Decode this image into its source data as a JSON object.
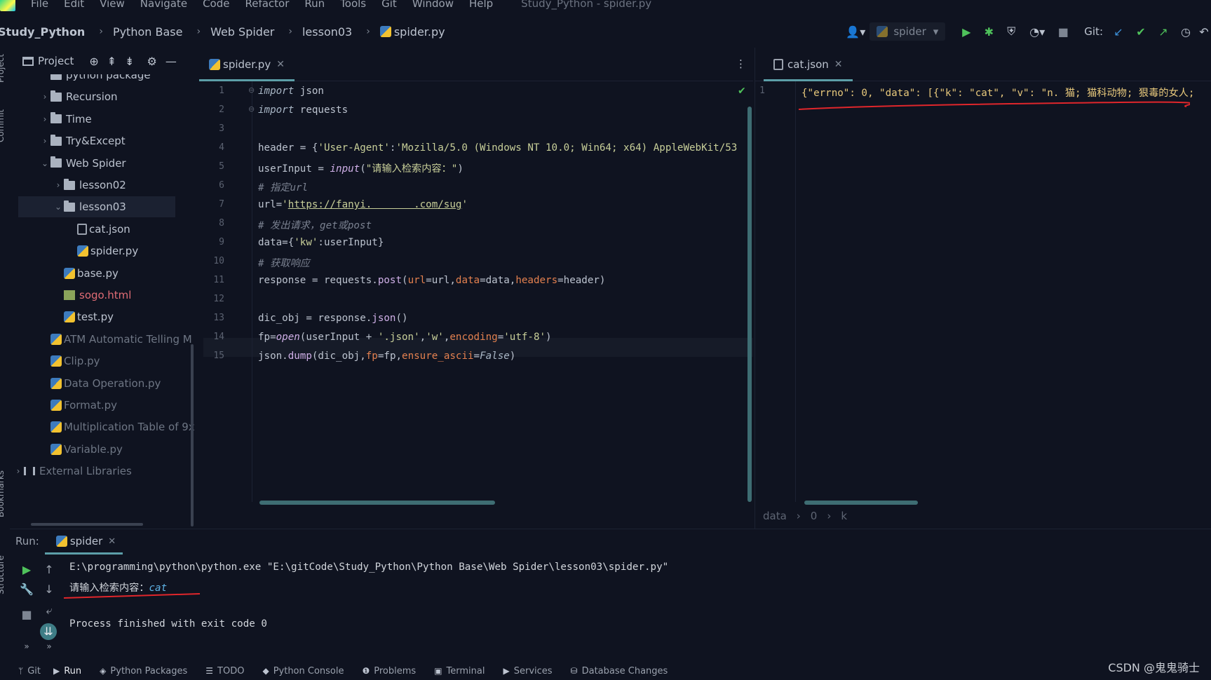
{
  "menubar": {
    "items": [
      "File",
      "Edit",
      "View",
      "Navigate",
      "Code",
      "Refactor",
      "Run",
      "Tools",
      "Git",
      "Window",
      "Help"
    ],
    "window_title": "Study_Python - spider.py"
  },
  "navbar": {
    "breadcrumb": [
      "Study_Python",
      "Python Base",
      "Web Spider",
      "lesson03",
      "spider.py"
    ],
    "run_config": "spider",
    "git_label": "Git:"
  },
  "side_labels": {
    "project": "Project",
    "commit": "Commit",
    "bookmarks": "Bookmarks",
    "structure": "Structure"
  },
  "project_panel": {
    "title": "Project",
    "tree": [
      {
        "label": "python package",
        "depth": 2,
        "kind": "folder",
        "state": "clipped"
      },
      {
        "label": "Recursion",
        "depth": 2,
        "kind": "folder",
        "arrow": "›"
      },
      {
        "label": "Time",
        "depth": 2,
        "kind": "folder",
        "arrow": "›"
      },
      {
        "label": "Try&Except",
        "depth": 2,
        "kind": "folder",
        "arrow": "›"
      },
      {
        "label": "Web Spider",
        "depth": 2,
        "kind": "folder",
        "arrow": "⌄"
      },
      {
        "label": "lesson02",
        "depth": 3,
        "kind": "folder",
        "arrow": "›"
      },
      {
        "label": "lesson03",
        "depth": 3,
        "kind": "folder",
        "arrow": "⌄",
        "selected": true
      },
      {
        "label": "cat.json",
        "depth": 4,
        "kind": "json"
      },
      {
        "label": "spider.py",
        "depth": 4,
        "kind": "py"
      },
      {
        "label": "base.py",
        "depth": 3,
        "kind": "py"
      },
      {
        "label": "sogo.html",
        "depth": 3,
        "kind": "html",
        "color": "red"
      },
      {
        "label": "test.py",
        "depth": 3,
        "kind": "py"
      },
      {
        "label": "ATM Automatic Telling M",
        "depth": 2,
        "kind": "py",
        "dim": true
      },
      {
        "label": "Clip.py",
        "depth": 2,
        "kind": "py",
        "dim": true
      },
      {
        "label": "Data Operation.py",
        "depth": 2,
        "kind": "py",
        "dim": true
      },
      {
        "label": "Format.py",
        "depth": 2,
        "kind": "py",
        "dim": true
      },
      {
        "label": "Multiplication Table of 9x",
        "depth": 2,
        "kind": "py",
        "dim": true
      },
      {
        "label": "Variable.py",
        "depth": 2,
        "kind": "py",
        "dim": true
      },
      {
        "label": "External Libraries",
        "depth": 0,
        "kind": "lib",
        "arrow": "›",
        "dim": true
      }
    ]
  },
  "editor_left": {
    "tab": "spider.py",
    "lines": [
      "1",
      "2",
      "3",
      "4",
      "5",
      "6",
      "7",
      "8",
      "9",
      "10",
      "11",
      "12",
      "13",
      "14",
      "15"
    ],
    "code": {
      "l1_kw": "import",
      "l1_rest": " json",
      "l2_kw": "import",
      "l2_rest": " requests",
      "l4_a": "header = {",
      "l4_s1": "'User-Agent'",
      "l4_b": ":",
      "l4_s2": "'Mozilla/5.0 (Windows NT 10.0; Win64; x64) AppleWebKit/53",
      "l5_a": "userInput = ",
      "l5_fn": "input",
      "l5_b": "(",
      "l5_s": "\"请输入检索内容：\"",
      "l5_c": ")",
      "l6": "# 指定url",
      "l7_a": "url=",
      "l7_q1": "'",
      "l7_url": "https://fanyi.       .com/sug",
      "l7_q2": "'",
      "l8": "# 发出请求，get或post",
      "l9_a": "data={",
      "l9_s": "'kw'",
      "l9_b": ":userInput}",
      "l10": "# 获取响应",
      "l11_a": "response = requests.",
      "l11_fn": "post",
      "l11_b": "(",
      "l11_p1": "url",
      "l11_c": "=url,",
      "l11_p2": "data",
      "l11_d": "=data,",
      "l11_p3": "headers",
      "l11_e": "=header)",
      "l13_a": "dic_obj = response.",
      "l13_fn": "json",
      "l13_b": "()",
      "l14_a": "fp=",
      "l14_fn": "open",
      "l14_b": "(userInput + ",
      "l14_s1": "'.json'",
      "l14_c": ",",
      "l14_s2": "'w'",
      "l14_d": ",",
      "l14_p": "encoding",
      "l14_e": "=",
      "l14_s3": "'utf-8'",
      "l14_f": ")",
      "l15_a": "json.",
      "l15_fn": "dump",
      "l15_b": "(dic_obj,",
      "l15_p1": "fp",
      "l15_c": "=fp,",
      "l15_p2": "ensure_ascii",
      "l15_d": "=",
      "l15_kw": "False",
      "l15_e": ")"
    }
  },
  "editor_right": {
    "tab": "cat.json",
    "line_no": "1",
    "content": "{\"errno\": 0, \"data\": [{\"k\": \"cat\", \"v\": \"n. 猫; 猫科动物; 狠毒的女人;"
  },
  "editor_breadcrumb": [
    "data",
    "0",
    "k"
  ],
  "run_panel": {
    "label": "Run:",
    "tab": "spider",
    "console": {
      "cmd": "E:\\programming\\python\\python.exe \"E:\\gitCode\\Study_Python\\Python Base\\Web Spider\\lesson03\\spider.py\"",
      "prompt": "请输入检索内容：",
      "input": "cat",
      "exit": "Process finished with exit code 0"
    }
  },
  "tool_windows": [
    {
      "label": "Git",
      "glyph": "ᛘ"
    },
    {
      "label": "Run",
      "glyph": "▶",
      "active": true
    },
    {
      "label": "Python Packages",
      "glyph": "◈"
    },
    {
      "label": "TODO",
      "glyph": "☰"
    },
    {
      "label": "Python Console",
      "glyph": "◆"
    },
    {
      "label": "Problems",
      "glyph": "❶"
    },
    {
      "label": "Terminal",
      "glyph": "▣"
    },
    {
      "label": "Services",
      "glyph": "▶"
    },
    {
      "label": "Database Changes",
      "glyph": "⛁"
    }
  ],
  "watermark": "CSDN @鬼鬼骑士",
  "colors": {
    "bg": "#0f1320",
    "accent": "#5c9ea8",
    "annotation": "#e0262b",
    "run_green": "#4fc25b"
  }
}
